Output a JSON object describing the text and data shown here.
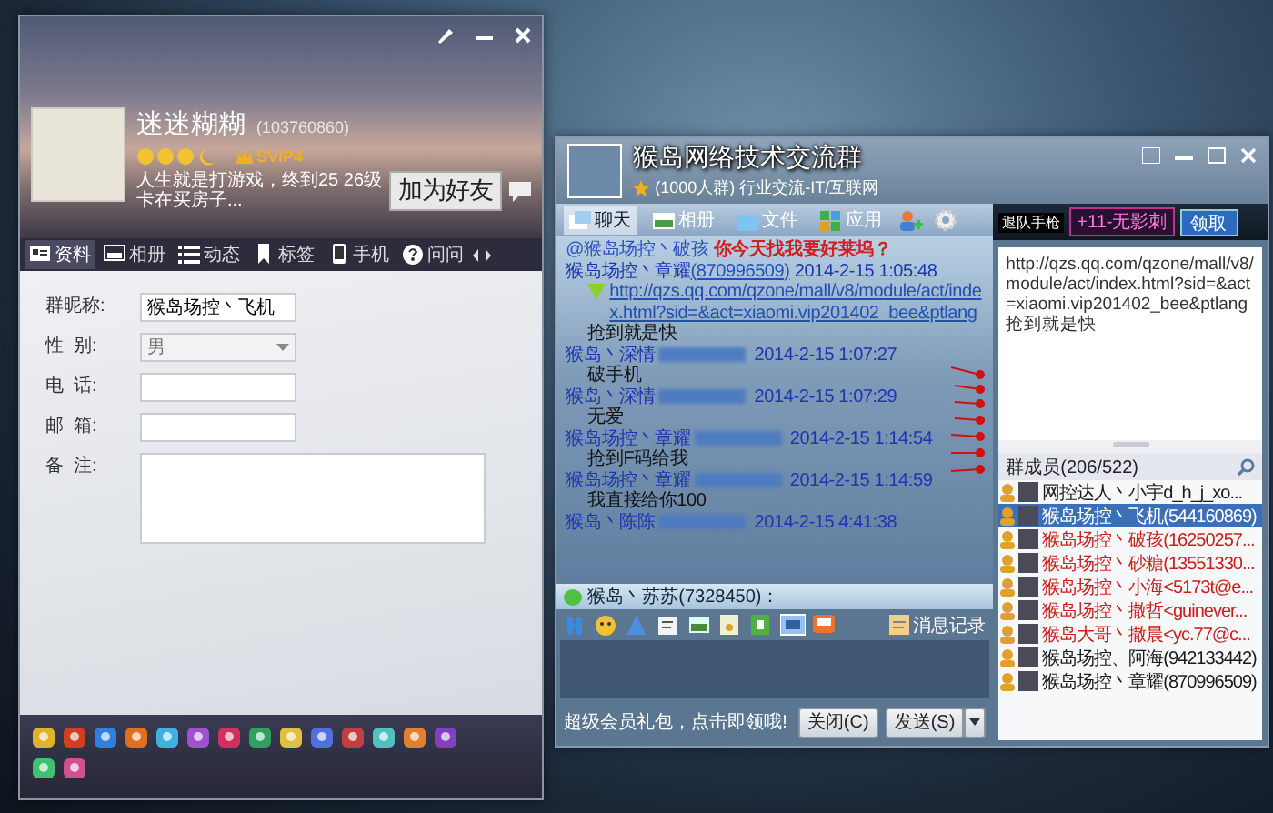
{
  "profile_window": {
    "nickname": "迷迷糊糊",
    "qq_number": "(103760860)",
    "vip_badge": "SVIP4",
    "signature": "人生就是打游戏，终到25 26级卡在买房子...",
    "add_friend_button": "加为好友",
    "tabs": [
      {
        "label": "资料",
        "selected": true
      },
      {
        "label": "相册",
        "selected": false
      },
      {
        "label": "动态",
        "selected": false
      },
      {
        "label": "标签",
        "selected": false
      },
      {
        "label": "手机",
        "selected": false
      },
      {
        "label": "问问",
        "selected": false
      }
    ],
    "form": [
      {
        "label": "群昵称:",
        "kind": "text",
        "value": "猴岛场控丶飞机"
      },
      {
        "label": "性  别:",
        "kind": "select",
        "value": "男"
      },
      {
        "label": "电  话:",
        "kind": "text"
      },
      {
        "label": "邮  箱:",
        "kind": "text"
      },
      {
        "label": "备  注:",
        "kind": "textarea"
      }
    ]
  },
  "chat_window": {
    "title": "猴岛网络技术交流群",
    "subtitle": "(1000人群) 行业交流-IT/互联网",
    "tabs": [
      {
        "label": "聊天",
        "selected": true
      },
      {
        "label": "相册",
        "selected": false
      },
      {
        "label": "文件",
        "selected": false
      },
      {
        "label": "应用",
        "selected": false
      }
    ],
    "promo": {
      "text": "+11-无影刺",
      "button": "领取",
      "caption": "退队手枪"
    },
    "messages": [
      {
        "kind": "mention",
        "mention": "@猴岛场控丶破孩",
        "text": "你今天找我要好莱坞？"
      },
      {
        "kind": "message",
        "sender": "猴岛场控丶章耀",
        "sender_id": "(870996509)",
        "id_redacted": false,
        "time": "2014-2-15 1:05:48",
        "link": "http://qzs.qq.com/qzone/mall/v8/module/act/index.html?sid=&act=xiaomi.vip201402_bee&ptlang",
        "text": "抢到就是快"
      },
      {
        "kind": "message",
        "sender": "猴岛丶深情",
        "id_redacted": true,
        "time": "2014-2-15 1:07:27",
        "text": "破手机"
      },
      {
        "kind": "message",
        "sender": "猴岛丶深情",
        "id_redacted": true,
        "time": "2014-2-15 1:07:29",
        "text": "无爱"
      },
      {
        "kind": "message",
        "sender": "猴岛场控丶章耀",
        "id_redacted": true,
        "time": "2014-2-15 1:14:54",
        "text": "抢到F码给我"
      },
      {
        "kind": "message",
        "sender": "猴岛场控丶章耀",
        "id_redacted": true,
        "time": "2014-2-15 1:14:59",
        "text": "我直接给你100"
      },
      {
        "kind": "message",
        "sender": "猴岛丶陈陈",
        "id_redacted": true,
        "time": "2014-2-15 4:41:38"
      }
    ],
    "input_header": "猴岛丶苏苏(7328450)：",
    "history_button": "消息记录",
    "footer_promo": "超级会员礼包，点击即领哦!",
    "close_button": "关闭(C)",
    "send_button": "发送(S)",
    "announcement": "http://qzs.qq.com/qzone/mall/v8/module/act/index.html?sid=&act=xiaomi.vip201402_bee&ptlang抢到就是快",
    "members_header": "群成员(206/522)",
    "members": [
      {
        "name": "网控达人丶小宇d_h_j_xo...",
        "color": "#1a1a1a",
        "selected": false
      },
      {
        "name": "猴岛场控丶飞机(544160869)",
        "selected": true
      },
      {
        "name": "猴岛场控丶破孩(16250257...",
        "color": "#c8201c",
        "selected": false
      },
      {
        "name": "猴岛场控丶砂糖(13551330...",
        "color": "#c8201c",
        "selected": false
      },
      {
        "name": "猴岛场控丶小海<5173t@e...",
        "color": "#c8201c",
        "selected": false
      },
      {
        "name": "猴岛场控丶撒哲<guinever...",
        "color": "#c8201c",
        "selected": false
      },
      {
        "name": "猴岛大哥丶撒晨<yc.77@c...",
        "color": "#c8201c",
        "selected": false
      },
      {
        "name": "猴岛场控、阿海(942133442)",
        "color": "#1a1a1a",
        "selected": false
      },
      {
        "name": "猴岛场控丶章耀(870996509)",
        "color": "#1a1a1a",
        "selected": false
      }
    ]
  }
}
